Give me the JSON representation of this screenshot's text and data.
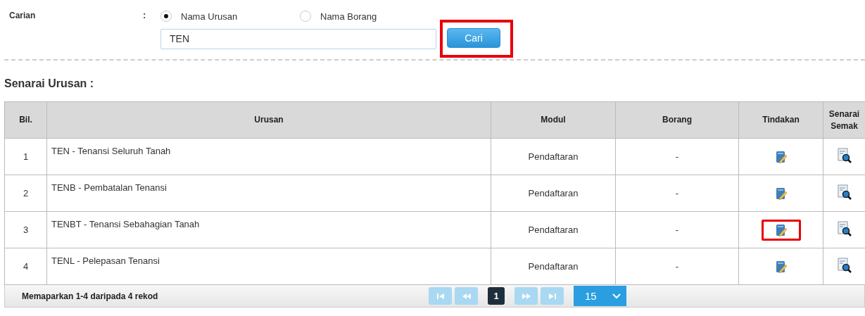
{
  "search": {
    "label": "Carian",
    "separator": ":",
    "options": [
      {
        "label": "Nama Urusan",
        "selected": true
      },
      {
        "label": "Nama Borang",
        "selected": false
      }
    ],
    "value": "TEN",
    "button": {
      "label": "Cari",
      "highlighted": true
    }
  },
  "section_title": "Senarai Urusan :",
  "table": {
    "columns": [
      "Bil.",
      "Urusan",
      "Modul",
      "Borang",
      "Tindakan",
      "Senarai Semak"
    ],
    "rows": [
      {
        "no": "1",
        "urusan": "TEN - Tenansi Seluruh Tanah",
        "modul": "Pendaftaran",
        "borang": "-",
        "action_highlighted": false
      },
      {
        "no": "2",
        "urusan": "TENB - Pembatalan Tenansi",
        "modul": "Pendaftaran",
        "borang": "-",
        "action_highlighted": false
      },
      {
        "no": "3",
        "urusan": "TENBT - Tenansi Sebahagian Tanah",
        "modul": "Pendaftaran",
        "borang": "-",
        "action_highlighted": true
      },
      {
        "no": "4",
        "urusan": "TENL - Pelepasan Tenansi",
        "modul": "Pendaftaran",
        "borang": "-",
        "action_highlighted": false
      }
    ]
  },
  "footer": {
    "summary": "Memaparkan 1-4 daripada 4 rekod",
    "pages": [
      {
        "label": "1",
        "selected": true
      }
    ],
    "page_size": "15"
  }
}
